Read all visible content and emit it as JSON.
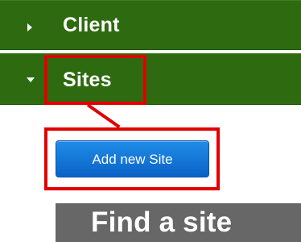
{
  "nav": {
    "client": {
      "label": "Client",
      "expanded": false,
      "caret_icon": "chevron-right-icon"
    },
    "sites": {
      "label": "Sites",
      "expanded": true,
      "caret_icon": "chevron-down-icon"
    }
  },
  "actions": {
    "add_site_label": "Add new Site"
  },
  "find_site": {
    "title": "Find a site"
  },
  "colors": {
    "nav_green": "#2e6b10",
    "highlight_red": "#e00000",
    "button_blue": "#0b62c8",
    "panel_gray": "#676767"
  }
}
